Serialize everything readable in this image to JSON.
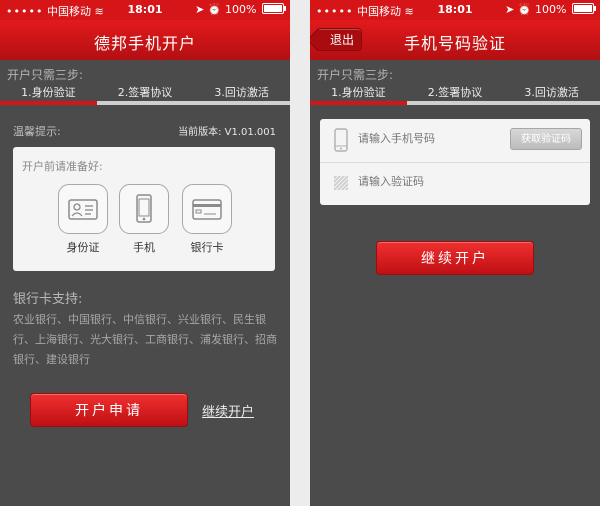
{
  "statusbar": {
    "carrier": "中国移动",
    "time": "18:01",
    "battery": "100%"
  },
  "left": {
    "nav_title": "德邦手机开户",
    "steps_caption": "开户只需三步:",
    "steps": [
      "1.身份验证",
      "2.签署协议",
      "3.回访激活"
    ],
    "tip_label": "温馨提示:",
    "version": "当前版本: V1.01.001",
    "prep_title": "开户前请准备好:",
    "prep_items": [
      {
        "label": "身份证",
        "icon": "id-card-icon"
      },
      {
        "label": "手机",
        "icon": "phone-icon"
      },
      {
        "label": "银行卡",
        "icon": "bank-card-icon"
      }
    ],
    "bank_title": "银行卡支持:",
    "bank_list": "农业银行、中国银行、中信银行、兴业银行、民生银行、上海银行、光大银行、工商银行、浦发银行、招商银行、建设银行",
    "apply_label": "开户申请",
    "continue_label": "继续开户"
  },
  "right": {
    "nav_title": "手机号码验证",
    "back_label": "退出",
    "steps_caption": "开户只需三步:",
    "steps": [
      "1.身份验证",
      "2.签署协议",
      "3.回访激活"
    ],
    "phone_placeholder": "请输入手机号码",
    "code_button": "获取验证码",
    "code_placeholder": "请输入验证码",
    "continue_label": "继续开户"
  },
  "progress": {
    "step_fraction": 0.333
  },
  "colors": {
    "accent": "#d61518",
    "background": "#4b4b4b",
    "card": "#f4f4f4"
  }
}
